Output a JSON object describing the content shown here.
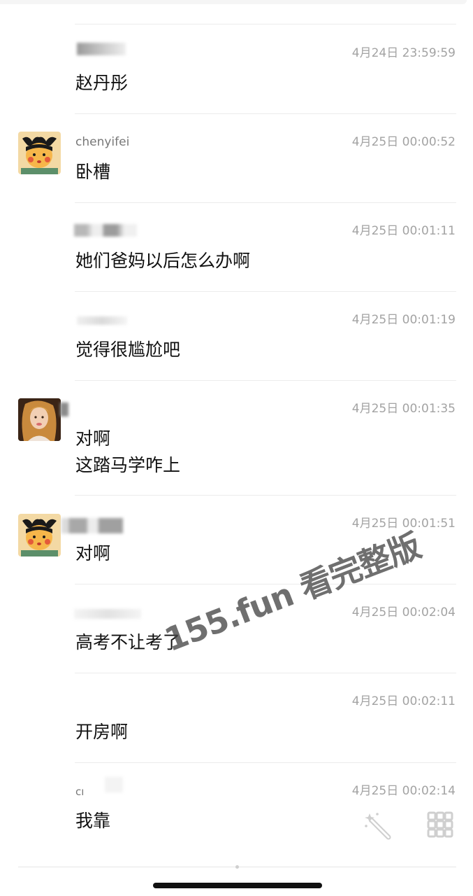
{
  "messages": [
    {
      "sender": "",
      "time": "4月24日 23:59:59",
      "lines": [
        "赵丹彤"
      ],
      "avatar": "none"
    },
    {
      "sender": "chenyifei",
      "time": "4月25日 00:00:52",
      "lines": [
        "卧槽"
      ],
      "avatar": "cartoon-girl"
    },
    {
      "sender": "",
      "time": "4月25日 00:01:11",
      "lines": [
        "她们爸妈以后怎么办啊"
      ],
      "avatar": "none"
    },
    {
      "sender": "",
      "time": "4月25日 00:01:19",
      "lines": [
        "觉得很尴尬吧"
      ],
      "avatar": "none"
    },
    {
      "sender": "",
      "time": "4月25日 00:01:35",
      "lines": [
        "对啊",
        "这踏马学咋上"
      ],
      "avatar": "photo-girl"
    },
    {
      "sender": "",
      "time": "4月25日 00:01:51",
      "lines": [
        "对啊"
      ],
      "avatar": "cartoon-girl"
    },
    {
      "sender": "",
      "time": "4月25日 00:02:04",
      "lines": [
        "高考不让考了"
      ],
      "avatar": "none"
    },
    {
      "sender": "",
      "time": "4月25日 00:02:11",
      "lines": [
        "开房啊"
      ],
      "avatar": "none"
    },
    {
      "sender": "cı",
      "time": "4月25日 00:02:14",
      "lines": [
        "我靠"
      ],
      "avatar": "none"
    }
  ],
  "watermark": {
    "text": "155.fun 看完整版"
  },
  "icons": {
    "magic": "magic-wand-icon",
    "grid": "grid-icon"
  },
  "colors": {
    "time": "#a3a3a3",
    "text": "#111111",
    "sender": "#777777",
    "divider": "#ececec"
  }
}
